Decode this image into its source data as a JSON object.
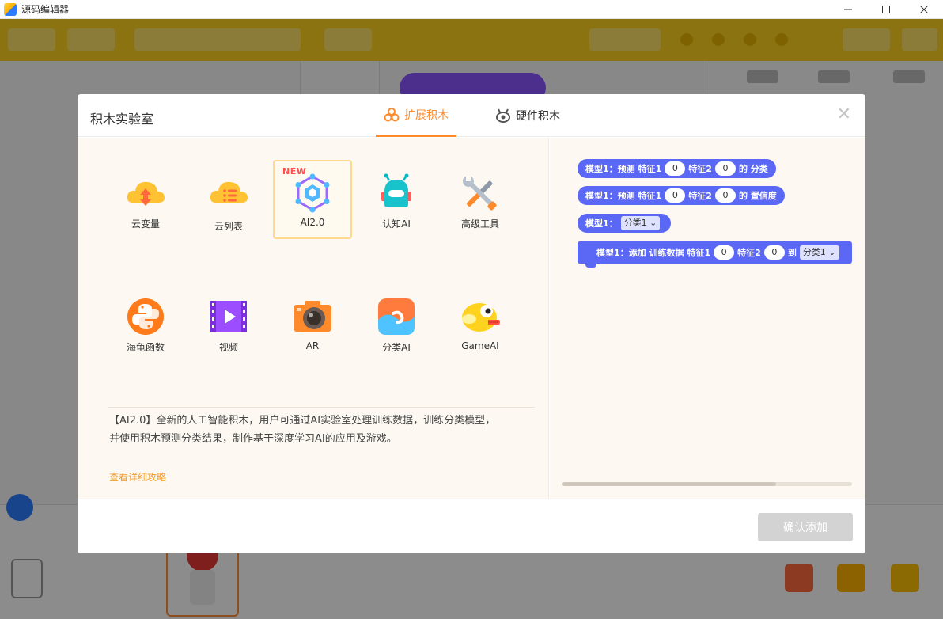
{
  "window": {
    "title": "源码编辑器"
  },
  "modal": {
    "title": "积木实验室",
    "tabs": [
      {
        "label": "扩展积木",
        "active": true
      },
      {
        "label": "硬件积木",
        "active": false
      }
    ],
    "extensions": [
      {
        "label": "云变量"
      },
      {
        "label": "云列表"
      },
      {
        "label": "AI2.0",
        "badge": "NEW",
        "selected": true
      },
      {
        "label": "认知AI"
      },
      {
        "label": "高级工具"
      },
      {
        "label": "海龟函数"
      },
      {
        "label": "视频"
      },
      {
        "label": "AR"
      },
      {
        "label": "分类AI"
      },
      {
        "label": "GameAI"
      }
    ],
    "description_line1": "【AI2.0】全新的人工智能积木，用户可通过AI实验室处理训练数据，训练分类模型，",
    "description_line2": "并使用积木预测分类结果，制作基于深度学习AI的应用及游戏。",
    "guide_link": "查看详细攻略",
    "blocks": {
      "b1": {
        "model": "模型1",
        "colon": "：",
        "verb": "预测",
        "f1": "特征1",
        "v1": "0",
        "f2": "特征2",
        "v2": "0",
        "tail": "的 分类"
      },
      "b2": {
        "model": "模型1",
        "colon": "：",
        "verb": "预测",
        "f1": "特征1",
        "v1": "0",
        "f2": "特征2",
        "v2": "0",
        "tail": "的 置信度"
      },
      "b3": {
        "model": "模型1",
        "colon": "：",
        "option": "分类1 ⌄"
      },
      "b4": {
        "model": "模型1",
        "colon": "：",
        "verb": "添加 训练数据",
        "f1": "特征1",
        "v1": "0",
        "f2": "特征2",
        "v2": "0",
        "to": "到",
        "option": "分类1 ⌄"
      }
    },
    "confirm_label": "确认添加",
    "close_glyph": "✕"
  },
  "colors": {
    "accent": "#ff8a2b",
    "block": "#5b67f5",
    "link": "#f49b2d"
  }
}
